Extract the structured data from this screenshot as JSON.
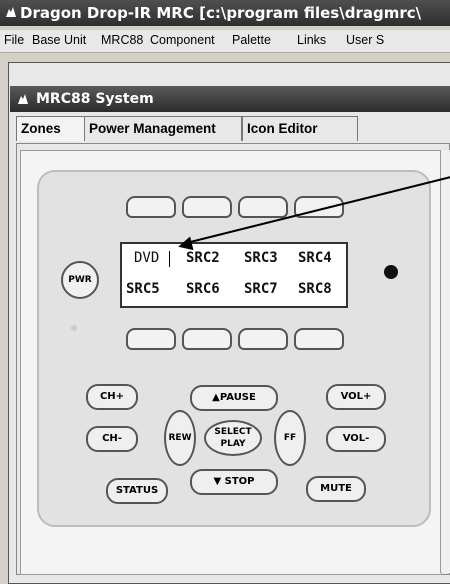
{
  "window": {
    "title": "Dragon Drop-IR MRC [c:\\program files\\dragmrc\\"
  },
  "menubar": [
    "File",
    "Base Unit",
    "MRC88",
    "Component",
    "Palette",
    "Links",
    "User S"
  ],
  "child_window": {
    "title": "MRC88 System"
  },
  "tabs": [
    "Zones",
    "Power Management",
    "Icon Editor"
  ],
  "remote": {
    "power_label": "PWR",
    "lcd": {
      "row1": [
        "DVD",
        "SRC2",
        "SRC3",
        "SRC4"
      ],
      "row2": [
        "SRC5",
        "SRC6",
        "SRC7",
        "SRC8"
      ]
    },
    "buttons": {
      "ch_up": "CH+",
      "ch_down": "CH-",
      "pause": "▲PAUSE",
      "stop": "▼ STOP",
      "rew": "REW",
      "ff": "FF",
      "select": "SELECT",
      "play": "PLAY",
      "vol_up": "VOL+",
      "vol_down": "VOL-",
      "status": "STATUS",
      "mute": "MUTE"
    }
  }
}
